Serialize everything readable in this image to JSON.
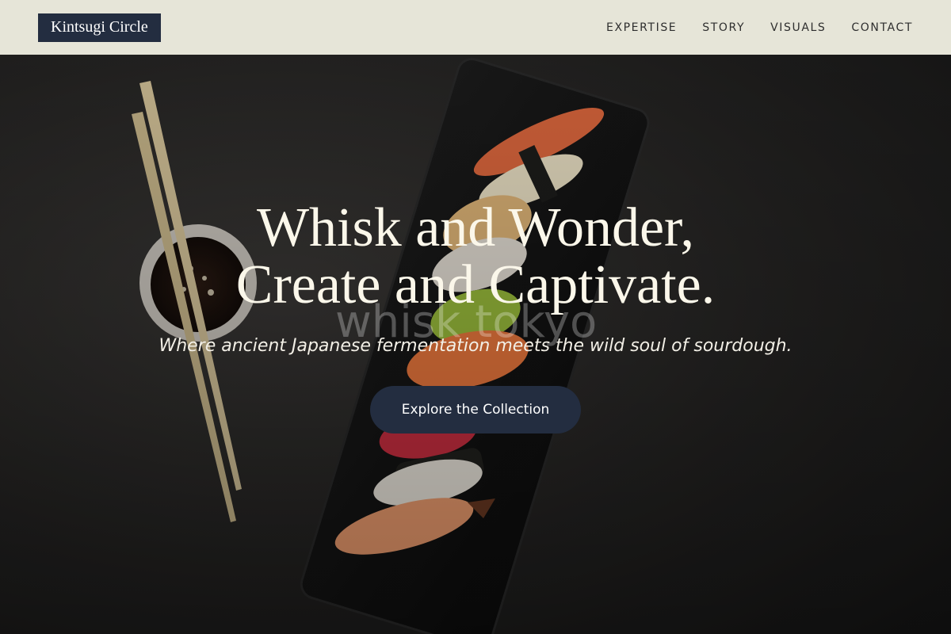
{
  "brand": {
    "logo_text": "Kintsugi Circle"
  },
  "nav": {
    "items": [
      {
        "label": "EXPERTISE"
      },
      {
        "label": "STORY"
      },
      {
        "label": "VISUALS"
      },
      {
        "label": "CONTACT"
      }
    ]
  },
  "hero": {
    "headline_line1": "Whisk and Wonder,",
    "headline_line2": "Create and Captivate.",
    "watermark": "whisk tokyo",
    "subtitle": "Where ancient Japanese fermentation meets the wild soul of sourdough.",
    "cta_label": "Explore the Collection"
  },
  "colors": {
    "header_bg": "#e6e5d8",
    "logo_bg": "#232d40",
    "button_bg": "#232d40",
    "headline": "#fbf7ea"
  }
}
